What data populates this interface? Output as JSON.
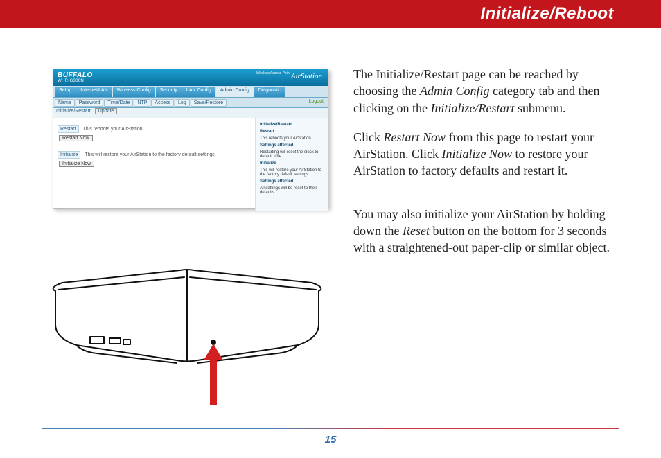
{
  "header": {
    "title": "Initialize/Reboot"
  },
  "body": {
    "p1_a": "The Initialize/Restart page can be reached by choosing the ",
    "p1_i1": "Admin Config",
    "p1_b": " category tab and then clicking on the ",
    "p1_i2": "Initialize/Restart",
    "p1_c": " submenu.",
    "p2_a": "Click ",
    "p2_i1": "Restart Now",
    "p2_b": " from this page to restart your AirStation.  Click ",
    "p2_i2": "Initialize Now",
    "p2_c": " to restore your AirStation to factory defaults and restart it.",
    "p3_a": "You may also initialize your AirStation by holding down the ",
    "p3_i1": "Reset",
    "p3_b": " button on the bottom for 3 seconds with a straightened-out paper-clip or similar object."
  },
  "screenshot": {
    "brand_logo": "BUFFALO",
    "model": "WHR-G300N",
    "product": "AirStation",
    "product_sub": "Wireless Access Point",
    "tabs": [
      "Setup",
      "Internet/LAN",
      "Wireless Config",
      "Security",
      "LAN Config",
      "Admin Config",
      "Diagnostic"
    ],
    "active_tab_index": 5,
    "subtabs": [
      "Name",
      "Password",
      "Time/Date",
      "NTP",
      "Access",
      "Log",
      "Save/Restore"
    ],
    "logout": "Logout",
    "section_title": "Initialize/Restart",
    "update_btn": "Update",
    "rows": {
      "restart_label": "Restart",
      "restart_text": "This reboots your AirStation.",
      "restart_btn": "Restart Now",
      "init_label": "Initialize",
      "init_text": "This will restore your AirStation to the factory default settings.",
      "init_btn": "Initialize Now"
    },
    "help": {
      "h1": "Initialize/Restart",
      "h2": "Restart",
      "p2": "This reboots your AirStation.",
      "h2a": "Settings affected:",
      "p2a": "Restarting will reset the clock to default time.",
      "h3": "Initialize",
      "p3": "This will restore your AirStation to the factory default settings.",
      "h3a": "Settings affected:",
      "p3a": "All settings will be reset to their defaults."
    }
  },
  "footer": {
    "page": "15"
  }
}
